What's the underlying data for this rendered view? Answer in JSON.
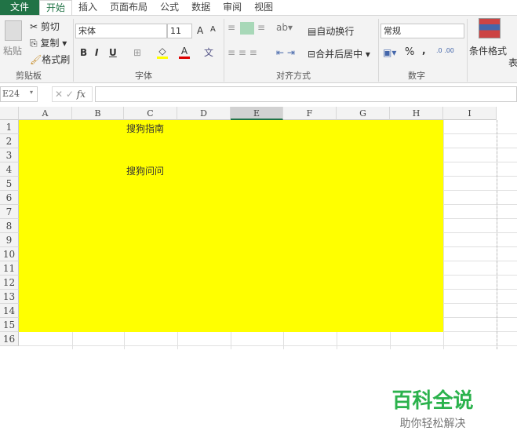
{
  "tabs": [
    "文件",
    "开始",
    "插入",
    "页面布局",
    "公式",
    "数据",
    "审阅",
    "视图"
  ],
  "clipboard": {
    "paste": "粘贴",
    "cut": "剪切",
    "copy": "复制",
    "format_painter": "格式刷",
    "group": "剪贴板"
  },
  "font": {
    "name": "宋体",
    "size": "11",
    "grow": "A",
    "shrink": "A",
    "bold": "B",
    "italic": "I",
    "underline": "U",
    "wen": "文",
    "group": "字体"
  },
  "alignment": {
    "wrap": "自动换行",
    "merge": "合并后居中",
    "group": "对齐方式"
  },
  "number": {
    "format": "常规",
    "percent": "%",
    "comma": ",",
    "group": "数字"
  },
  "styles": {
    "conditional": "条件格式",
    "table": "表"
  },
  "formula_bar": {
    "name_box": "E24",
    "fx": "fx",
    "value": ""
  },
  "columns": [
    "A",
    "B",
    "C",
    "D",
    "E",
    "F",
    "G",
    "H",
    "I"
  ],
  "rows": [
    "1",
    "2",
    "3",
    "4",
    "5",
    "6",
    "7",
    "8",
    "9",
    "10",
    "11",
    "12",
    "13",
    "14",
    "15",
    "16"
  ],
  "cells": {
    "C1": "搜狗指南",
    "C4": "搜狗问问"
  },
  "watermark": {
    "title": "百科全说",
    "subtitle": "助你轻松解决"
  },
  "colors": {
    "fill": "#ffff00",
    "accent": "#217346"
  }
}
